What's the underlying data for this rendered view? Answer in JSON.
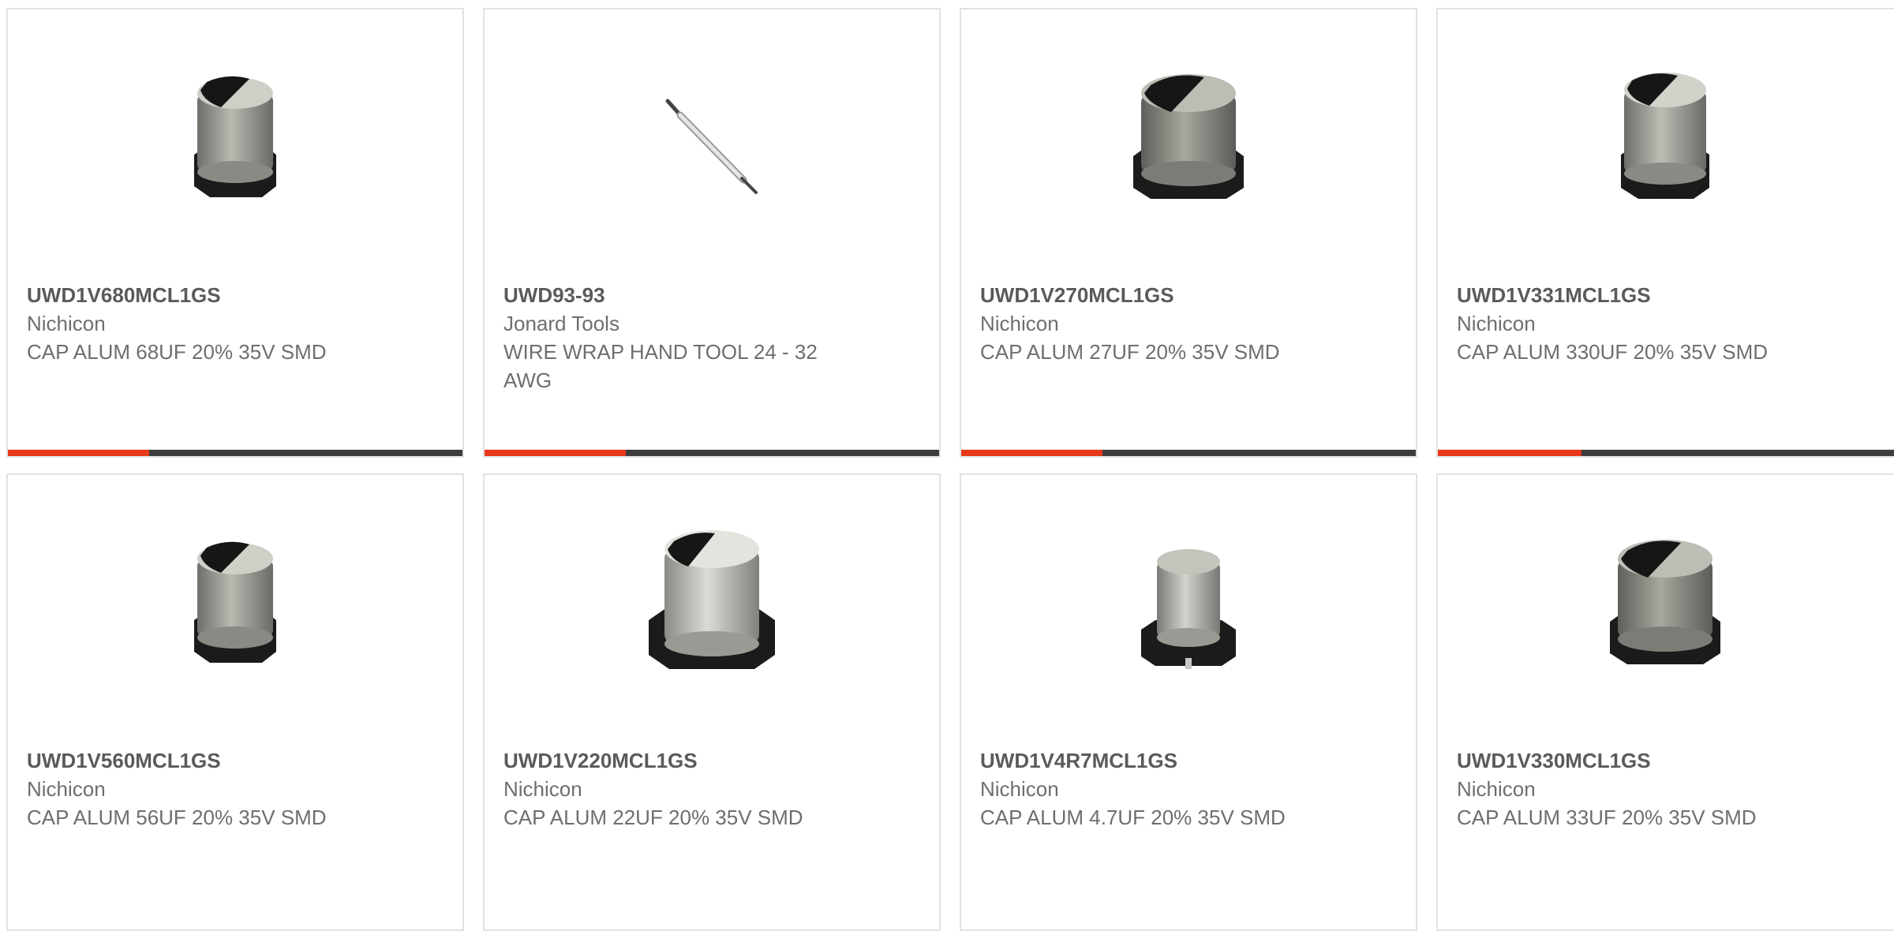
{
  "colors": {
    "progress_fill": "#e8391a",
    "progress_track": "#3d3d3d",
    "card_border": "#e2e2e2"
  },
  "products": [
    {
      "part_number": "UWD1V680MCL1GS",
      "manufacturer": "Nichicon",
      "description": "CAP ALUM 68UF 20% 35V SMD",
      "image_icon": "capacitor-icon",
      "progress": 0.31
    },
    {
      "part_number": "UWD93-93",
      "manufacturer": "Jonard Tools",
      "description": "WIRE WRAP HAND TOOL 24 - 32 AWG",
      "image_icon": "wire-wrap-tool-icon",
      "progress": 0.31
    },
    {
      "part_number": "UWD1V270MCL1GS",
      "manufacturer": "Nichicon",
      "description": "CAP ALUM 27UF 20% 35V SMD",
      "image_icon": "capacitor-icon",
      "progress": 0.31
    },
    {
      "part_number": "UWD1V331MCL1GS",
      "manufacturer": "Nichicon",
      "description": "CAP ALUM 330UF 20% 35V SMD",
      "image_icon": "capacitor-icon",
      "progress": 0.31
    },
    {
      "part_number": "UWD1V560MCL1GS",
      "manufacturer": "Nichicon",
      "description": "CAP ALUM 56UF 20% 35V SMD",
      "image_icon": "capacitor-icon"
    },
    {
      "part_number": "UWD1V220MCL1GS",
      "manufacturer": "Nichicon",
      "description": "CAP ALUM 22UF 20% 35V SMD",
      "image_icon": "capacitor-icon"
    },
    {
      "part_number": "UWD1V4R7MCL1GS",
      "manufacturer": "Nichicon",
      "description": "CAP ALUM 4.7UF 20% 35V SMD",
      "image_icon": "capacitor-small-icon"
    },
    {
      "part_number": "UWD1V330MCL1GS",
      "manufacturer": "Nichicon",
      "description": "CAP ALUM 33UF 20% 35V SMD",
      "image_icon": "capacitor-icon"
    }
  ]
}
